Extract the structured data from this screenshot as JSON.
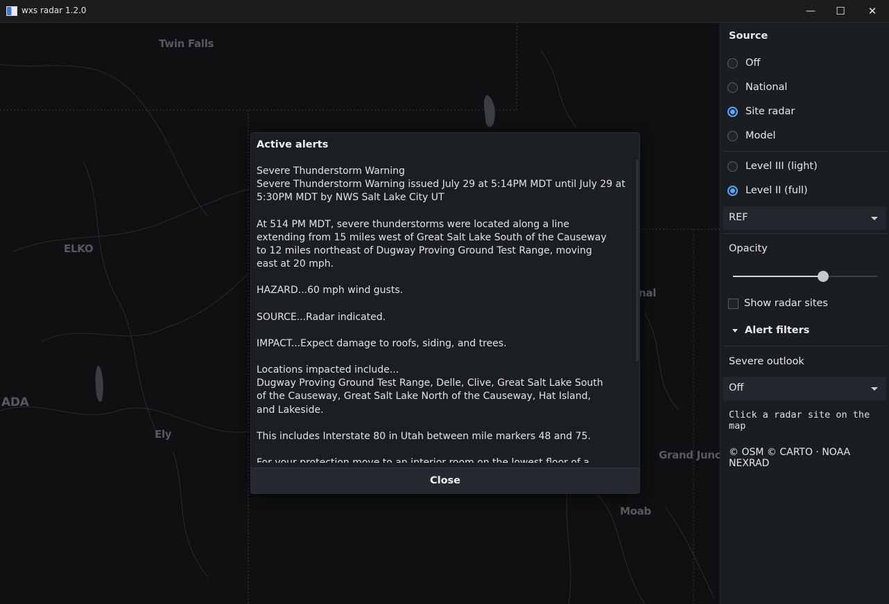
{
  "window": {
    "title": "wxs radar 1.2.0",
    "minimize_glyph": "—",
    "maximize_glyph": "☐",
    "close_glyph": "✕"
  },
  "map": {
    "labels": {
      "twin_falls": "Twin Falls",
      "elko": "ELKO",
      "ada": "ADA",
      "ely": "Ely",
      "moab": "Moab",
      "grand_junction": "Grand Junct",
      "partial_nal": "nal"
    }
  },
  "alerts_modal": {
    "title": "Active alerts",
    "paragraphs": [
      "Severe Thunderstorm Warning\nSevere Thunderstorm Warning issued July 29 at 5:14PM MDT until July 29 at\n5:30PM MDT by NWS Salt Lake City UT",
      "At 514 PM MDT, severe thunderstorms were located along a line\nextending from 15 miles west of Great Salt Lake South of the Causeway\nto 12 miles northeast of Dugway Proving Ground Test Range, moving\neast at 20 mph.",
      "HAZARD...60 mph wind gusts.",
      "SOURCE...Radar indicated.",
      "IMPACT...Expect damage to roofs, siding, and trees.",
      "Locations impacted include...\nDugway Proving Ground Test Range, Delle, Clive, Great Salt Lake South\nof the Causeway, Great Salt Lake North of the Causeway, Hat Island,\nand Lakeside.",
      "This includes Interstate 80 in Utah between mile markers 48 and 75.",
      "For your protection move to an interior room on the lowest floor of a"
    ],
    "close_label": "Close"
  },
  "panel": {
    "source_heading": "Source",
    "source_options": [
      {
        "label": "Off",
        "selected": false
      },
      {
        "label": "National",
        "selected": false
      },
      {
        "label": "Site radar",
        "selected": true
      },
      {
        "label": "Model",
        "selected": false
      }
    ],
    "level_options": [
      {
        "label": "Level III (light)",
        "selected": false
      },
      {
        "label": "Level II (full)",
        "selected": true
      }
    ],
    "product_select": "REF",
    "opacity_label": "Opacity",
    "opacity_value": 0.6,
    "show_sites_label": "Show radar sites",
    "show_sites_checked": false,
    "alert_filters_label": "Alert filters",
    "severe_outlook_label": "Severe outlook",
    "severe_outlook_select": "Off",
    "hint_text": "Click a radar site on the map",
    "attribution": "© OSM © CARTO · NOAA NEXRAD"
  },
  "colors": {
    "accent": "#58a6ff",
    "panel_bg": "#1a1d22",
    "map_bg": "#101012"
  }
}
